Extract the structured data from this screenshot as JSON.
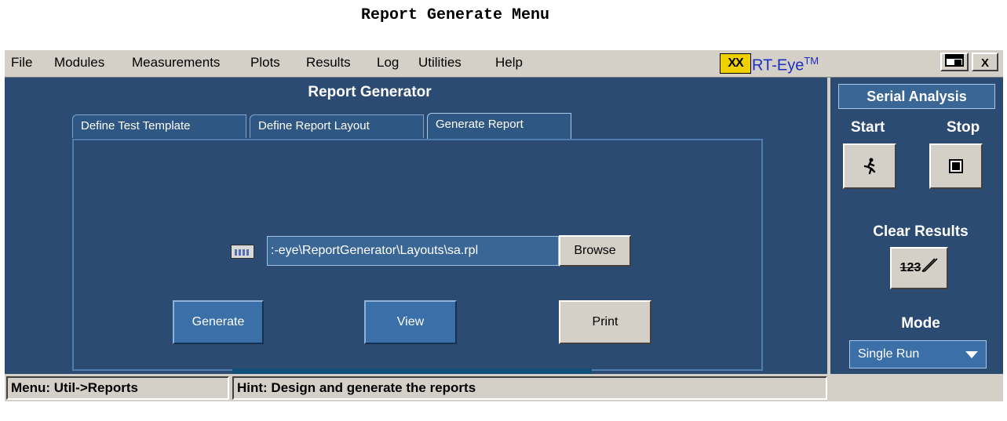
{
  "caption": "Report Generate Menu",
  "menubar": {
    "items": [
      "File",
      "Modules",
      "Measurements",
      "Plots",
      "Results",
      "Log",
      "Utilities",
      "Help"
    ],
    "logo_text": "XX",
    "brand": "RT-Eye",
    "brand_tm": "TM",
    "minimize_label": "▭",
    "close_label": "X"
  },
  "main": {
    "title": "Report Generator",
    "tabs": [
      {
        "label": "Define Test Template",
        "active": false
      },
      {
        "label": "Define Report Layout",
        "active": false
      },
      {
        "label": "Generate Report",
        "active": true
      }
    ],
    "file_path": ":-eye\\ReportGenerator\\Layouts\\sa.rpl",
    "browse_label": "Browse",
    "generate_label": "Generate",
    "view_label": "View",
    "print_label": "Print"
  },
  "side": {
    "title": "Serial Analysis",
    "start_label": "Start",
    "stop_label": "Stop",
    "clear_results_label": "Clear Results",
    "clear_icon_text": "123",
    "mode_label": "Mode",
    "mode_value": "Single Run"
  },
  "status": {
    "menu": "Menu: Util->Reports",
    "hint": "Hint: Design and generate the reports"
  },
  "colors": {
    "panel_bg": "#2b4b73",
    "chrome_bg": "#d4d0c8",
    "button_blue": "#3a6fa8",
    "logo_yellow": "#f0d000",
    "progress_bar": "#0f4f7a"
  }
}
